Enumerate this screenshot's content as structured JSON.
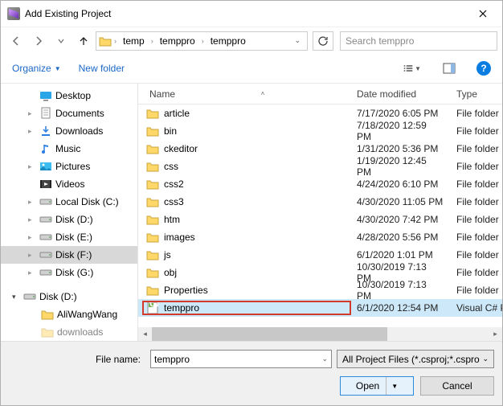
{
  "title": "Add Existing Project",
  "breadcrumbs": [
    "temp",
    "temppro",
    "temppro"
  ],
  "search_placeholder": "Search temppro",
  "toolbar": {
    "organize": "Organize",
    "new_folder": "New folder"
  },
  "tree": {
    "desktop": "Desktop",
    "documents": "Documents",
    "downloads": "Downloads",
    "music": "Music",
    "pictures": "Pictures",
    "videos": "Videos",
    "localc": "Local Disk (C:)",
    "diskd": "Disk (D:)",
    "diske": "Disk (E:)",
    "diskf": "Disk (F:)",
    "diskg": "Disk (G:)",
    "diskd2": "Disk (D:)",
    "aliwang": "AliWangWang",
    "dl2": "downloads"
  },
  "columns": {
    "name": "Name",
    "date": "Date modified",
    "type": "Type"
  },
  "files": [
    {
      "name": "article",
      "date": "7/17/2020 6:05 PM",
      "type": "File folder",
      "kind": "folder"
    },
    {
      "name": "bin",
      "date": "7/18/2020 12:59 PM",
      "type": "File folder",
      "kind": "folder"
    },
    {
      "name": "ckeditor",
      "date": "1/31/2020 5:36 PM",
      "type": "File folder",
      "kind": "folder"
    },
    {
      "name": "css",
      "date": "1/19/2020 12:45 PM",
      "type": "File folder",
      "kind": "folder"
    },
    {
      "name": "css2",
      "date": "4/24/2020 6:10 PM",
      "type": "File folder",
      "kind": "folder"
    },
    {
      "name": "css3",
      "date": "4/30/2020 11:05 PM",
      "type": "File folder",
      "kind": "folder"
    },
    {
      "name": "htm",
      "date": "4/30/2020 7:42 PM",
      "type": "File folder",
      "kind": "folder"
    },
    {
      "name": "images",
      "date": "4/28/2020 5:56 PM",
      "type": "File folder",
      "kind": "folder"
    },
    {
      "name": "js",
      "date": "6/1/2020 1:01 PM",
      "type": "File folder",
      "kind": "folder"
    },
    {
      "name": "obj",
      "date": "10/30/2019 7:13 PM",
      "type": "File folder",
      "kind": "folder"
    },
    {
      "name": "Properties",
      "date": "10/30/2019 7:13 PM",
      "type": "File folder",
      "kind": "folder"
    },
    {
      "name": "temppro",
      "date": "6/1/2020 12:54 PM",
      "type": "Visual C# Pro",
      "kind": "csproj",
      "selected": true
    }
  ],
  "filename_label": "File name:",
  "filename_value": "temppro",
  "filter": "All Project Files (*.csproj;*.cspro",
  "buttons": {
    "open": "Open",
    "cancel": "Cancel"
  }
}
